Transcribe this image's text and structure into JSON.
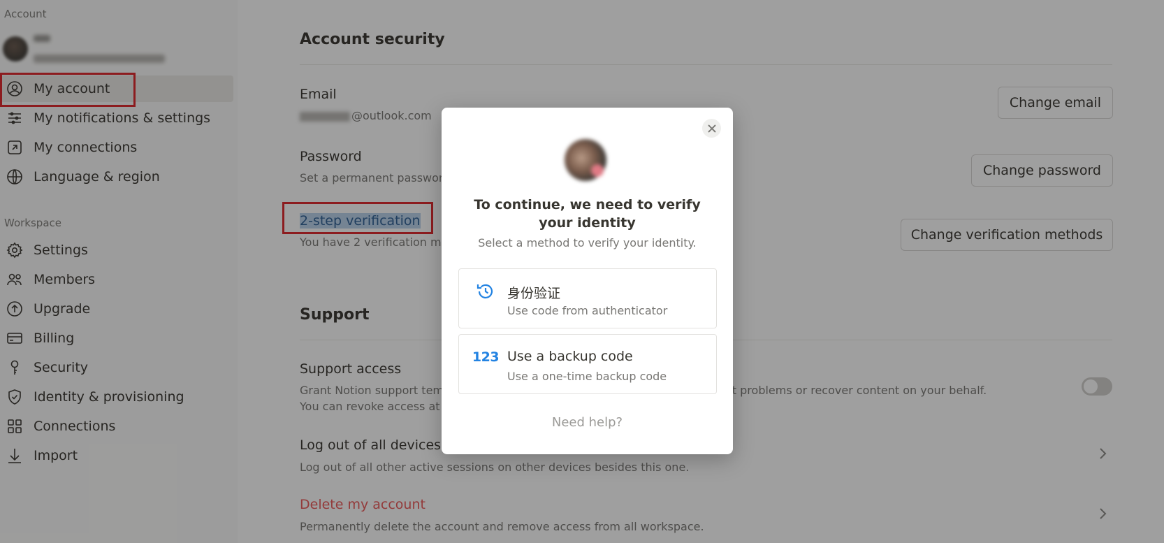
{
  "sidebar": {
    "account_heading": "Account",
    "account_items": [
      {
        "label": "My account",
        "icon": "user-circle-icon",
        "active": true
      },
      {
        "label": "My notifications & settings",
        "icon": "sliders-icon"
      },
      {
        "label": "My connections",
        "icon": "external-link-icon"
      },
      {
        "label": "Language & region",
        "icon": "globe-icon"
      }
    ],
    "workspace_heading": "Workspace",
    "workspace_items": [
      {
        "label": "Settings",
        "icon": "gear-icon"
      },
      {
        "label": "Members",
        "icon": "people-icon"
      },
      {
        "label": "Upgrade",
        "icon": "arrow-up-circle-icon"
      },
      {
        "label": "Billing",
        "icon": "credit-card-icon"
      },
      {
        "label": "Security",
        "icon": "key-icon"
      },
      {
        "label": "Identity & provisioning",
        "icon": "shield-check-icon"
      },
      {
        "label": "Connections",
        "icon": "grid-icon"
      },
      {
        "label": "Import",
        "icon": "download-arrow-icon"
      }
    ]
  },
  "main": {
    "account_security": {
      "title": "Account security",
      "email_label": "Email",
      "email_value": "@outlook.com",
      "change_email": "Change email",
      "password_label": "Password",
      "password_desc": "Set a permanent passwor",
      "change_password": "Change password",
      "two_step_label": "2-step verification",
      "two_step_desc": "You have 2 verification me",
      "change_methods": "Change verification methods"
    },
    "support": {
      "title": "Support",
      "support_access_label": "Support access",
      "support_access_desc_1": "Grant Notion support tem",
      "support_access_desc_1_tail": "ot problems or recover content on your behalf.",
      "support_access_desc_2": "You can revoke access at a",
      "logout_label": "Log out of all devices",
      "logout_desc": "Log out of all other active sessions on other devices besides this one.",
      "delete_label": "Delete my account",
      "delete_desc": "Permanently delete the account and remove access from all workspace."
    }
  },
  "modal": {
    "title": "To continue, we need to verify your identity",
    "subtitle": "Select a method to verify your identity.",
    "methods": [
      {
        "title": "身份验证",
        "desc": "Use code from authenticator",
        "icon": "authenticator-clock-icon"
      },
      {
        "title": "Use a backup code",
        "desc": "Use a one-time backup code",
        "icon_text": "123"
      }
    ],
    "help": "Need help?"
  },
  "colors": {
    "accent_blue": "#2383e2",
    "danger_red": "#eb5757",
    "annotation_red": "#e0252b",
    "selection_blue": "#b9d2ec"
  }
}
